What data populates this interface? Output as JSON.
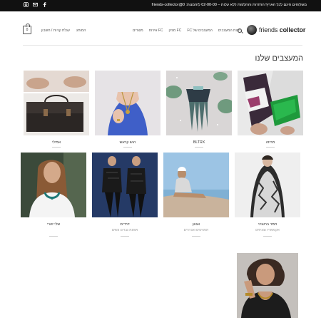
{
  "topbar": {
    "message": "משלוחים חינם לכל הארץ! החזרות והחלפות ללא עלות – 02-00-00 להזמנות: 0@friends-collector",
    "social": [
      "instagram-icon",
      "mail-icon",
      "facebook-icon"
    ]
  },
  "header": {
    "logo_text_light": "friends ",
    "logo_text_bold": "collector",
    "cart_count": "0",
    "nav_left": [
      "המותג",
      "עגלת קניות / חשבון"
    ],
    "nav_right": [
      "חנות המעצבים",
      "המעצבים של FC",
      "FC מגזין",
      "FC אירוח",
      "מוצרים"
    ]
  },
  "section": {
    "title": "המעצבים שלנו"
  },
  "row1": [
    {
      "name": "מרוזה"
    },
    {
      "name": "BLTRX"
    },
    {
      "name": "הוש קראש"
    },
    {
      "name": "אמילי"
    }
  ],
  "row2": [
    {
      "name": "תמר ברגעיני",
      "sub": "אקססוריז וצעיפים"
    },
    {
      "name": "אגוגן",
      "sub": "תכשיטים ואביזרים"
    },
    {
      "name": "דרדים",
      "sub": "אופנת גברים ונשים"
    },
    {
      "name": "שלי זהרי",
      "sub": ""
    }
  ],
  "colors": {
    "topbar": "#111111",
    "accent_green": "#1e9a3c"
  }
}
